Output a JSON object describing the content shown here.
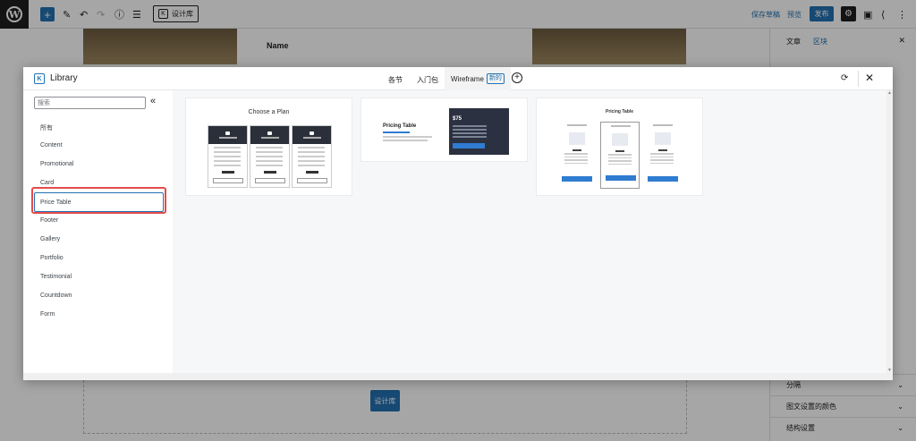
{
  "topbar": {
    "add_icon": "plus-icon",
    "library_button_label": "设计库",
    "library_button_icon_glyph": "K",
    "save_draft_label": "保存草稿",
    "preview_label": "预览",
    "publish_label": "发布"
  },
  "editor": {
    "heading_text": "Name",
    "library_button_label": "设计库"
  },
  "right_sidebar": {
    "tab_post": "文章",
    "tab_block": "区块",
    "rows": [
      "分隔",
      "图文设置的颜色",
      "结构设置"
    ]
  },
  "modal": {
    "title": "Library",
    "logo_glyph": "K",
    "tabs": [
      "各节",
      "入门包",
      "Wireframe"
    ],
    "active_tab": "Wireframe",
    "new_badge": "新的",
    "search_placeholder": "搜索",
    "nav_items": [
      "所有",
      "Content",
      "Promotional",
      "Card",
      "Price Table",
      "Footer",
      "Gallery",
      "Portfolio",
      "Testimonial",
      "Countdown",
      "Form"
    ],
    "selected_nav_item": "Price Table",
    "accent_color": "#2271b1",
    "highlight_color": "#e54b4b"
  },
  "cards": {
    "card1_title": "Choose a Plan",
    "card2_title": "Pricing Table",
    "card2_price": "$75",
    "card3_title": "Pricing Table"
  }
}
